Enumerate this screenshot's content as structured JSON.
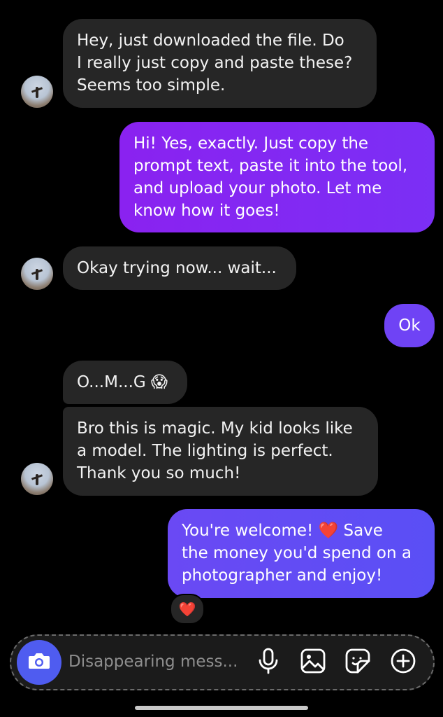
{
  "messages": [
    {
      "from": "them",
      "text": "Hey, just downloaded the file. Do\nI really just copy and paste these?\nSeems too simple."
    },
    {
      "from": "me",
      "text": "Hi! Yes, exactly. Just copy the\nprompt text, paste it into the tool,\nand upload your photo. Let me\nknow how it goes!"
    },
    {
      "from": "them",
      "text": "Okay trying now... wait..."
    },
    {
      "from": "me",
      "text": "Ok"
    },
    {
      "from": "them",
      "text": "O...M...G 😱"
    },
    {
      "from": "them",
      "text": "Bro this is magic. My kid looks like\na model. The lighting is perfect.\nThank you so much!"
    },
    {
      "from": "me",
      "text": "You're welcome! ❤️ Save\nthe money you'd spend on a\nphotographer and enjoy!"
    }
  ],
  "reaction": "❤️",
  "composer": {
    "placeholder": "Disappearing mess...",
    "icons": [
      "camera-icon",
      "microphone-icon",
      "gallery-icon",
      "sticker-icon",
      "plus-icon"
    ]
  },
  "colors": {
    "incoming_bubble": "#262626",
    "outgoing_purple": "#8a22f0",
    "outgoing_indigo": "#6a49f4",
    "camera_button": "#4f5cf0"
  }
}
